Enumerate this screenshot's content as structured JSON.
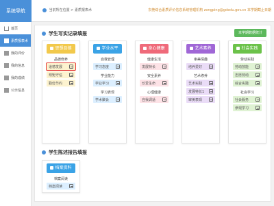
{
  "topbar": {
    "side_title": "系统导航",
    "location": "当前所在位置 > 素质报表术",
    "notice": "东莞综合素质评价信息系统管理机构 zongping@gdedu.gov.cn 本学期截止日期"
  },
  "sidebar": {
    "items": [
      {
        "label": "首页",
        "icon": "home-icon"
      },
      {
        "label": "素质报表术",
        "icon": "doc-icon"
      },
      {
        "label": "我的评价",
        "icon": "doc-icon"
      },
      {
        "label": "我的信息",
        "icon": "doc-icon"
      },
      {
        "label": "我的成绩",
        "icon": "doc-icon"
      },
      {
        "label": "公示信息",
        "icon": "doc-icon"
      }
    ]
  },
  "main": {
    "section1_title": "学生写实记录填报",
    "export_label": "本学期数据统计",
    "section2_title": "学生陈述报告填报"
  },
  "cards": [
    {
      "title": "思想品德",
      "color": "#f2c94c",
      "item_bg": "#fdf3cf",
      "groups": [
        {
          "label": "品德修养",
          "items": [
            "道德发展",
            "规矩守信",
            "勤俭节约"
          ]
        }
      ]
    },
    {
      "title": "学业水平",
      "color": "#3ba3e6",
      "item_bg": "#dcefff",
      "groups": [
        {
          "label": "自我管理",
          "items": [
            "学习态度"
          ]
        },
        {
          "label": "学业能力",
          "items": [
            "学业学习"
          ]
        },
        {
          "label": "学习表现",
          "items": [
            "学术聚会"
          ]
        }
      ]
    },
    {
      "title": "身心健康",
      "color": "#ef6a7a",
      "item_bg": "#fde2e6",
      "groups": [
        {
          "label": "健康生活",
          "items": [
            "发展特长"
          ]
        },
        {
          "label": "安全素养",
          "items": [
            "珍爱生命"
          ]
        },
        {
          "label": "心理健康",
          "items": [
            "自我调适"
          ]
        }
      ]
    },
    {
      "title": "艺术素养",
      "color": "#a067d6",
      "item_bg": "#eadcf7",
      "groups": [
        {
          "label": "审美情趣",
          "items": [
            "培养爱好"
          ]
        },
        {
          "label": "艺术修养",
          "items": [
            "艺术实践",
            "发展特长1",
            "审美表现"
          ]
        }
      ]
    },
    {
      "title": "社会实践",
      "color": "#6cc24a",
      "item_bg": "#dff2d3",
      "groups": [
        {
          "label": "劳动实践",
          "items": [
            "劳动技能",
            "志愿劳动",
            "综合实践"
          ]
        },
        {
          "label": "社会学习",
          "items": [
            "社会服务",
            "参观学习"
          ]
        }
      ]
    }
  ],
  "report_card": {
    "title": "档案资料",
    "color": "#3ba3e6",
    "item_bg": "#dcefff",
    "group_label": "档案阅读",
    "item": "档案阅读"
  }
}
